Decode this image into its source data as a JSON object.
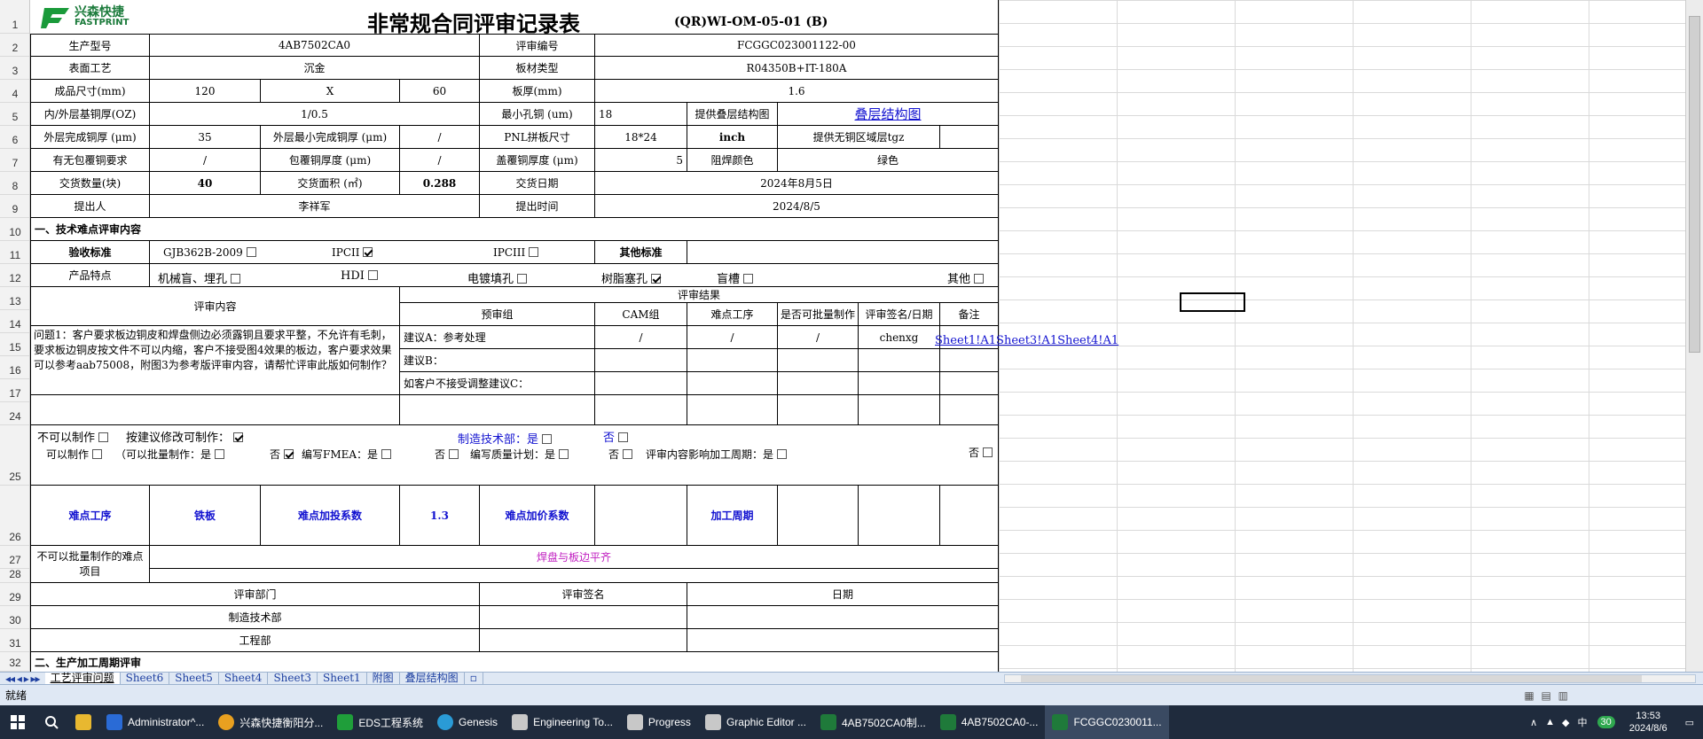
{
  "logo": {
    "cn": "兴森快捷",
    "en": "FASTPRINT"
  },
  "title": "非常规合同评审记录表",
  "form_code": "(QR)WI-OM-05-01 (B)",
  "row_numbers": [
    "1",
    "2",
    "3",
    "4",
    "5",
    "6",
    "7",
    "8",
    "9",
    "10",
    "11",
    "12",
    "13",
    "14",
    "15",
    "16",
    "17",
    "24",
    "25",
    "26",
    "27",
    "28",
    "29",
    "30",
    "31",
    "32"
  ],
  "fields": {
    "model_label": "生产型号",
    "model": "4AB7502CA0",
    "review_no_label": "评审编号",
    "review_no": "FCGGC023001122-00",
    "surface_label": "表面工艺",
    "surface": "沉金",
    "board_type_label": "板材类型",
    "board_type": "R04350B+IT-180A",
    "size_label": "成品尺寸(mm)",
    "size_w": "120",
    "size_x": "X",
    "size_h": "60",
    "thick_label": "板厚(mm)",
    "thick": "1.6",
    "copper_label": "内/外层基铜厚(OZ)",
    "copper": "1/0.5",
    "min_hole_label": "最小孔铜 (um)",
    "min_hole": "18",
    "stack_label": "提供叠层结构图",
    "stack_link": "叠层结构图",
    "outer_cu_label": "外层完成铜厚 (μm)",
    "outer_cu": "35",
    "outer_min_label": "外层最小完成铜厚 (μm)",
    "outer_min": "/",
    "pnl_label": "PNL拼板尺寸",
    "pnl": "18*24",
    "pnl_unit": "inch",
    "nocopper_label": "提供无铜区域层tgz",
    "wrap_req_label": "有无包覆铜要求",
    "wrap_req": "/",
    "wrap_thk_label": "包覆铜厚度 (μm)",
    "wrap_thk": "/",
    "cap_label": "盖覆铜厚度 (μm)",
    "cap": "5",
    "mask_label": "阻焊颜色",
    "mask": "绿色",
    "qty_label": "交货数量(块)",
    "qty": "40",
    "area_label": "交货面积 (㎡)",
    "area": "0.288",
    "date_label": "交货日期",
    "date": "2024年8月5日",
    "proposer_label": "提出人",
    "proposer": "李祥军",
    "time_label": "提出时间",
    "time": "2024/8/5"
  },
  "section1": "一、技术难点评审内容",
  "standards": {
    "label": "验收标准",
    "gjb": "GJB362B-2009",
    "ipc2": "IPCII",
    "ipc3": "IPCIII",
    "other": "其他标准"
  },
  "features": {
    "label": "产品特点",
    "f1": "机械盲、埋孔",
    "f2": "HDI",
    "f3": "电镀填孔",
    "f4": "树脂塞孔",
    "f5": "盲槽",
    "f6": "其他"
  },
  "review": {
    "content_label": "评审内容",
    "result_label": "评审结果",
    "cols": [
      "预审组",
      "CAM组",
      "难点工序",
      "是否可批量制作",
      "评审签名/日期",
      "备注"
    ],
    "question": "问题1：客户要求板边铜皮和焊盘侧边必须露铜且要求平整，不允许有毛刺，要求板边铜皮按文件不可以内缩，客户不接受图4效果的板边，客户要求效果可以参考aab75008，附图3为参考版评审内容，请帮忙评审此版如何制作？",
    "sugA": "建议A：参考处理",
    "sugB": "建议B：",
    "sugC": "如客户不接受调整建议C：",
    "rowA": [
      "/",
      "/",
      "/",
      "chenxg"
    ],
    "links": "Sheet1!A1Sheet3!A1Sheet4!A1"
  },
  "decision": {
    "cannot": "不可以制作",
    "suggest": "按建议修改可制作：",
    "mfg": "制造技术部：是",
    "no": "否",
    "can": "可以制作",
    "batch": "（可以批量制作：是",
    "fmea": "编写FMEA：是",
    "quality": "编写质量计划：是",
    "period": "评审内容影响加工周期：是"
  },
  "difficulty": {
    "proc": "难点工序",
    "proc_val": "铁板",
    "coef": "难点加投系数",
    "coef_val": "1.3",
    "price": "难点加价系数",
    "period": "加工周期"
  },
  "nonbatch": {
    "label": "不可以批量制作的难点项目",
    "value": "焊盘与板边平齐"
  },
  "sign": {
    "dept": "评审部门",
    "sign": "评审签名",
    "date": "日期",
    "d1": "制造技术部",
    "d2": "工程部"
  },
  "section2": "二、生产加工周期评审",
  "tabs": [
    "工艺评审问题",
    "Sheet6",
    "Sheet5",
    "Sheet4",
    "Sheet3",
    "Sheet1",
    "附图",
    "叠层结构图"
  ],
  "status": "就绪",
  "taskbar": {
    "items": [
      {
        "label": "Administrator^...",
        "color": "#2a6bd6"
      },
      {
        "label": "兴森快捷衡阳分...",
        "color": "#e8a020"
      },
      {
        "label": "EDS工程系统",
        "color": "#1f9e3a"
      },
      {
        "label": "Genesis",
        "color": "#2a9bd6"
      },
      {
        "label": "Engineering To...",
        "color": "#c8c8c8"
      },
      {
        "label": "Progress",
        "color": "#c8c8c8"
      },
      {
        "label": "Graphic Editor ...",
        "color": "#c8c8c8"
      },
      {
        "label": "4AB7502CA0制...",
        "color": "#1f7a3a"
      },
      {
        "label": "4AB7502CA0-...",
        "color": "#1f7a3a"
      },
      {
        "label": "FCGGC0230011...",
        "color": "#1f7a3a"
      }
    ],
    "time": "13:53",
    "date": "2024/8/6",
    "ime": "中",
    "badge": "30"
  }
}
